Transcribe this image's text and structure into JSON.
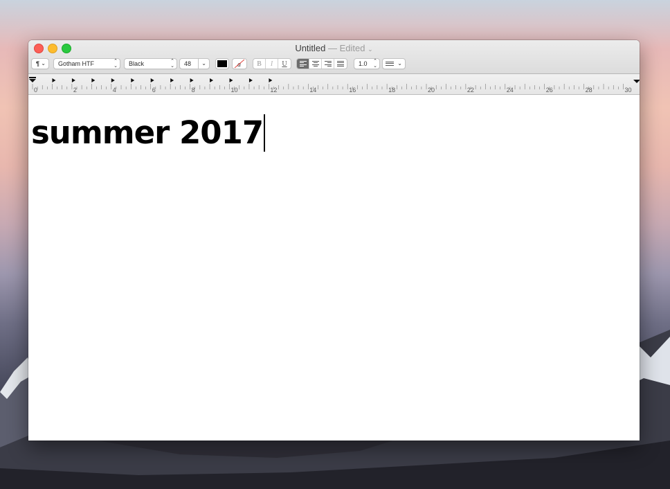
{
  "window": {
    "title": "Untitled",
    "edited_label": "— Edited"
  },
  "toolbar": {
    "paragraph_styles_glyph": "¶",
    "font_family": "Gotham HTF",
    "font_style": "Black",
    "font_size": "48",
    "bold_label": "B",
    "italic_label": "I",
    "underline_label": "U",
    "line_spacing": "1.0",
    "text_color": "#000000",
    "active_alignment": "left"
  },
  "ruler": {
    "labels": [
      "0",
      "2",
      "4",
      "6",
      "8",
      "10",
      "12",
      "14",
      "16",
      "18",
      "20",
      "22",
      "24",
      "26",
      "28",
      "30"
    ]
  },
  "document": {
    "text": "summer 2017"
  },
  "colors": {
    "close": "#fc5f57",
    "minimize": "#fdbc2e",
    "zoom": "#2ac940",
    "selected_segment": "#6d6d6d"
  }
}
